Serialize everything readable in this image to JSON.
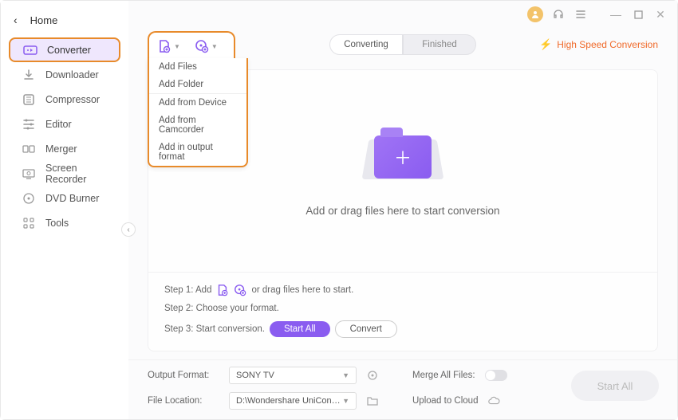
{
  "header": {
    "home": "Home"
  },
  "sidebar": {
    "items": [
      {
        "label": "Converter",
        "icon": "converter-icon",
        "active": true
      },
      {
        "label": "Downloader",
        "icon": "downloader-icon"
      },
      {
        "label": "Compressor",
        "icon": "compressor-icon"
      },
      {
        "label": "Editor",
        "icon": "editor-icon"
      },
      {
        "label": "Merger",
        "icon": "merger-icon"
      },
      {
        "label": "Screen Recorder",
        "icon": "screen-recorder-icon"
      },
      {
        "label": "DVD Burner",
        "icon": "dvd-burner-icon"
      },
      {
        "label": "Tools",
        "icon": "tools-icon"
      }
    ]
  },
  "tabs": {
    "converting": "Converting",
    "finished": "Finished"
  },
  "highspeed": "High Speed Conversion",
  "drop": {
    "prompt": "Add or drag files here to start conversion",
    "step1_pre": "Step 1: Add",
    "step1_post": "or drag files here to start.",
    "step2": "Step 2: Choose your format.",
    "step3": "Step 3: Start conversion.",
    "startall": "Start All",
    "convert": "Convert"
  },
  "dropdown": {
    "items": [
      "Add Files",
      "Add Folder",
      "Add from Device",
      "Add from Camcorder",
      "Add in output format"
    ]
  },
  "bottom": {
    "output_label": "Output Format:",
    "output_value": "SONY TV",
    "location_label": "File Location:",
    "location_value": "D:\\Wondershare UniConverter 1",
    "merge_label": "Merge All Files:",
    "upload_label": "Upload to Cloud"
  },
  "start_all_btn": "Start All"
}
